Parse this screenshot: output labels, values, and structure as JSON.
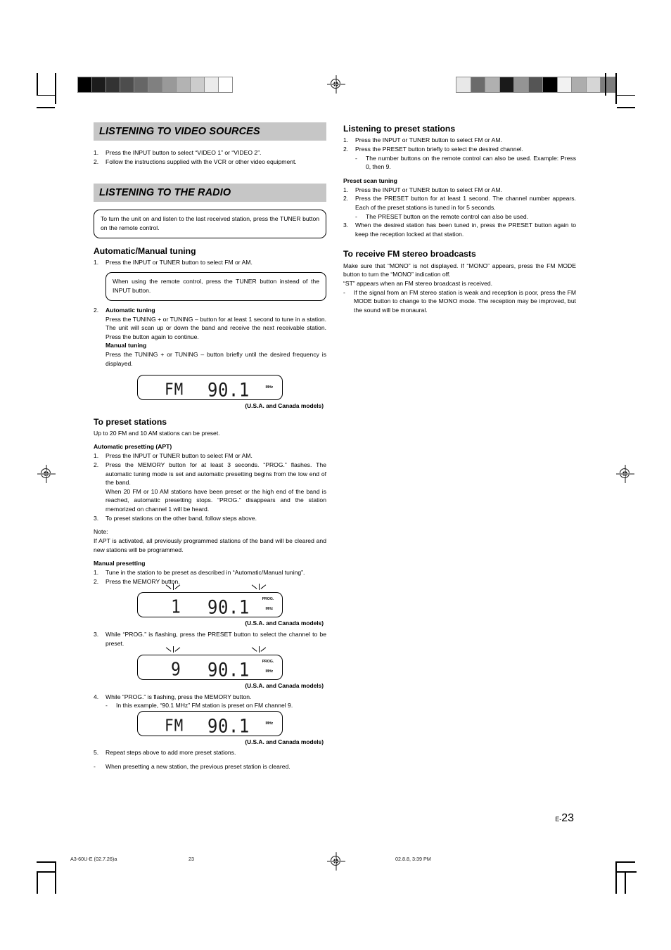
{
  "page": {
    "number_prefix": "E-",
    "number": "23"
  },
  "footer": {
    "file": "A3-60U-E (02.7.26)a",
    "page": "23",
    "date": "02.8.8, 3:39 PM"
  },
  "gray_wedge_left": [
    "#000000",
    "#1c1c1c",
    "#333333",
    "#4d4d4d",
    "#666666",
    "#808080",
    "#999999",
    "#b3b3b3",
    "#cccccc",
    "#ebebeb",
    "#ffffff"
  ],
  "gray_wedge_right": [
    "#e8e8e8",
    "#6b6b6b",
    "#b0b0b0",
    "#1a1a1a",
    "#949494",
    "#555555",
    "#000000",
    "#f2f2f2",
    "#adadad",
    "#d6d6d6",
    "#7d7d7d"
  ],
  "left_column": {
    "section_video": {
      "title": "LISTENING TO VIDEO SOURCES",
      "steps": [
        {
          "marker": "1.",
          "text": "Press the INPUT button to select “VIDEO 1” or “VIDEO 2”."
        },
        {
          "marker": "2.",
          "text": "Follow the instructions supplied with the VCR or other video equipment."
        }
      ]
    },
    "section_radio": {
      "title": "LISTENING TO THE RADIO",
      "callout": "To turn the unit on and listen to the last received station, press the TUNER button on the remote control.",
      "auto_manual": {
        "heading": "Automatic/Manual tuning",
        "step1_marker": "1.",
        "step1_text": "Press the INPUT or TUNER button to select FM or AM.",
        "callout": "When using the remote control, press the TUNER button instead of the INPUT button.",
        "step2_marker": "2.",
        "step2_heading": "Automatic tuning",
        "step2_text": "Press the TUNING + or TUNING – button for at least 1 second to tune in a station. The unit will scan up or down the band and receive the next receivable station. Press the button again to continue.",
        "manual_heading": "Manual tuning",
        "manual_text": "Press the TUNING + or TUNING – button briefly until the desired frequency is displayed."
      },
      "display_1": {
        "band": "FM",
        "frequency": "90.1",
        "unit": "MHz",
        "caption": "(U.S.A. and Canada models)"
      },
      "preset": {
        "heading": "To preset stations",
        "intro": "Up to 20 FM and 10 AM stations can be preset.",
        "apt_heading": "Automatic presetting (APT)",
        "apt_steps": [
          {
            "marker": "1.",
            "text": "Press the INPUT or TUNER button to select FM or AM."
          },
          {
            "marker": "2.",
            "text": "Press the MEMORY button for at least 3 seconds. “PROG.” flashes. The automatic tuning mode is set and automatic presetting begins from the low end of the band."
          },
          {
            "marker": "",
            "text": "When 20 FM or 10 AM stations have been preset or the high end of the band is reached, automatic presetting stops. “PROG.” disappears and the station memorized on channel 1 will be heard."
          },
          {
            "marker": "3.",
            "text": "To preset stations on the other band, follow steps above."
          }
        ],
        "note_label": "Note:",
        "note_text": "If APT is activated, all previously programmed stations of the band will be cleared and new stations will be programmed.",
        "manual_heading": "Manual presetting",
        "manual_steps": [
          {
            "marker": "1.",
            "text": "Tune in the station to be preset as described in “Automatic/Manual tuning”."
          },
          {
            "marker": "2.",
            "text": "Press the MEMORY button."
          }
        ],
        "step3_marker": "3.",
        "step3_text": "While “PROG.” is flashing, press the PRESET button to select the channel to be preset.",
        "step4_marker": "4.",
        "step4_text": "While “PROG.” is flashing, press the MEMORY button.",
        "step4_sub_marker": "-",
        "step4_sub_text": "In this example, “90.1 MHz” FM station is preset on FM channel 9.",
        "step5_marker": "5.",
        "step5_text": "Repeat steps above to add more preset stations.",
        "final_marker": "-",
        "final_text": "When presetting a new station, the previous preset station is cleared."
      },
      "display_2": {
        "channel": "1",
        "frequency": "90.1",
        "prog": "PROG.",
        "unit": "MHz",
        "caption": "(U.S.A. and Canada models)"
      },
      "display_3": {
        "channel": "9",
        "frequency": "90.1",
        "prog": "PROG.",
        "unit": "MHz",
        "caption": "(U.S.A. and Canada models)"
      },
      "display_4": {
        "band": "FM",
        "frequency": "90.1",
        "unit": "MHz",
        "caption": "(U.S.A. and Canada models)"
      }
    }
  },
  "right_column": {
    "listening_preset": {
      "heading": "Listening to preset stations",
      "steps": [
        {
          "marker": "1.",
          "text": "Press the INPUT or TUNER button to select FM or AM."
        },
        {
          "marker": "2.",
          "text": "Press the PRESET button briefly to select the desired channel."
        }
      ],
      "sub_marker": "-",
      "sub_text": "The number buttons on the remote control can also be used. Example: Press 0, then 9."
    },
    "preset_scan": {
      "heading": "Preset scan tuning",
      "steps": [
        {
          "marker": "1.",
          "text": "Press the INPUT or TUNER button to select FM or AM."
        },
        {
          "marker": "2.",
          "text": "Press the PRESET button for at least 1 second. The channel number appears. Each of the preset stations is tuned in for 5 seconds."
        }
      ],
      "sub_marker": "-",
      "sub_text": "The PRESET button on the remote control can also be used.",
      "step3_marker": "3.",
      "step3_text": "When the desired station has been tuned in, press the PRESET button again to keep the reception locked at that station."
    },
    "fm_stereo": {
      "heading": "To receive FM stereo broadcasts",
      "para1": "Make sure that “MONO” is not displayed. If “MONO” appears, press the FM MODE button to turn the “MONO” indication off.",
      "para2": "“ST” appears when an FM stereo broadcast is received.",
      "sub_marker": "-",
      "sub_text": "If the signal from an FM stereo station is weak and reception is poor, press the FM MODE button to change to the MONO mode. The reception may be improved, but the sound will be monaural."
    }
  }
}
